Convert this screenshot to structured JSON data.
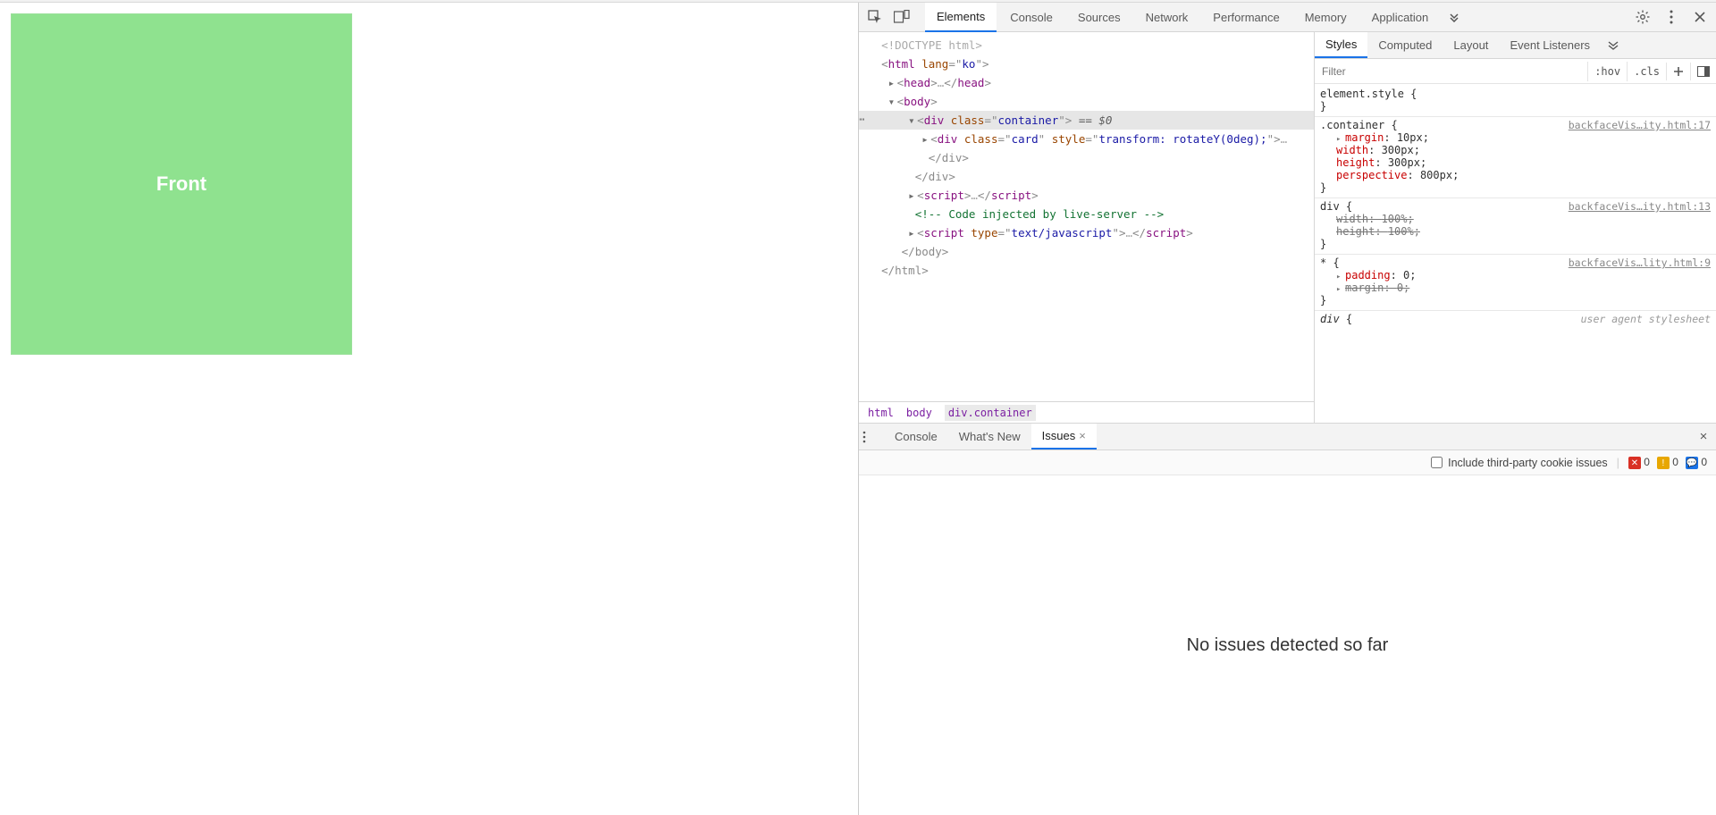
{
  "page": {
    "card_text": "Front"
  },
  "devtools": {
    "tabs": [
      "Elements",
      "Console",
      "Sources",
      "Network",
      "Performance",
      "Memory",
      "Application"
    ],
    "active_tab": "Elements",
    "styles_tabs": [
      "Styles",
      "Computed",
      "Layout",
      "Event Listeners"
    ],
    "styles_active": "Styles",
    "filter_placeholder": "Filter",
    "filter_btn_hov": ":hov",
    "filter_btn_cls": ".cls",
    "breadcrumbs": [
      "html",
      "body",
      "div.container"
    ],
    "tree": {
      "doctype": "<!DOCTYPE html>",
      "html_open": "html",
      "html_lang_attr": "lang",
      "html_lang_val": "ko",
      "head": "head",
      "body": "body",
      "div": "div",
      "class_attr": "class",
      "container_val": "container",
      "selected_suffix": " == $0",
      "card_val": "card",
      "style_attr": "style",
      "card_style_val": "transform: rotateY(0deg);",
      "script": "script",
      "type_attr": "type",
      "type_val": "text/javascript",
      "comment": " Code injected by live-server ",
      "close_div": "</div>",
      "close_body": "</body>",
      "close_html": "</html>"
    },
    "styles": {
      "element_style_selector": "element.style",
      "rules": [
        {
          "selector": ".container",
          "source": "backfaceVis…ity.html:17",
          "decls": [
            {
              "prop": "margin",
              "val": "10px",
              "tri": true
            },
            {
              "prop": "width",
              "val": "300px"
            },
            {
              "prop": "height",
              "val": "300px"
            },
            {
              "prop": "perspective",
              "val": "800px"
            }
          ]
        },
        {
          "selector": "div",
          "source": "backfaceVis…ity.html:13",
          "decls": [
            {
              "prop": "width",
              "val": "100%",
              "strike": true
            },
            {
              "prop": "height",
              "val": "100%",
              "strike": true
            }
          ]
        },
        {
          "selector": "*",
          "source": "backfaceVis…lity.html:9",
          "decls": [
            {
              "prop": "padding",
              "val": "0",
              "tri": true
            },
            {
              "prop": "margin",
              "val": "0",
              "strike": true,
              "tri": true
            }
          ]
        }
      ],
      "ua_selector": "div",
      "ua_label": "user agent stylesheet"
    },
    "drawer": {
      "tabs": [
        "Console",
        "What's New",
        "Issues"
      ],
      "active": "Issues",
      "include_third_party": "Include third-party cookie issues",
      "counts": {
        "errors": "0",
        "warnings": "0",
        "messages": "0"
      },
      "body_text": "No issues detected so far"
    }
  }
}
